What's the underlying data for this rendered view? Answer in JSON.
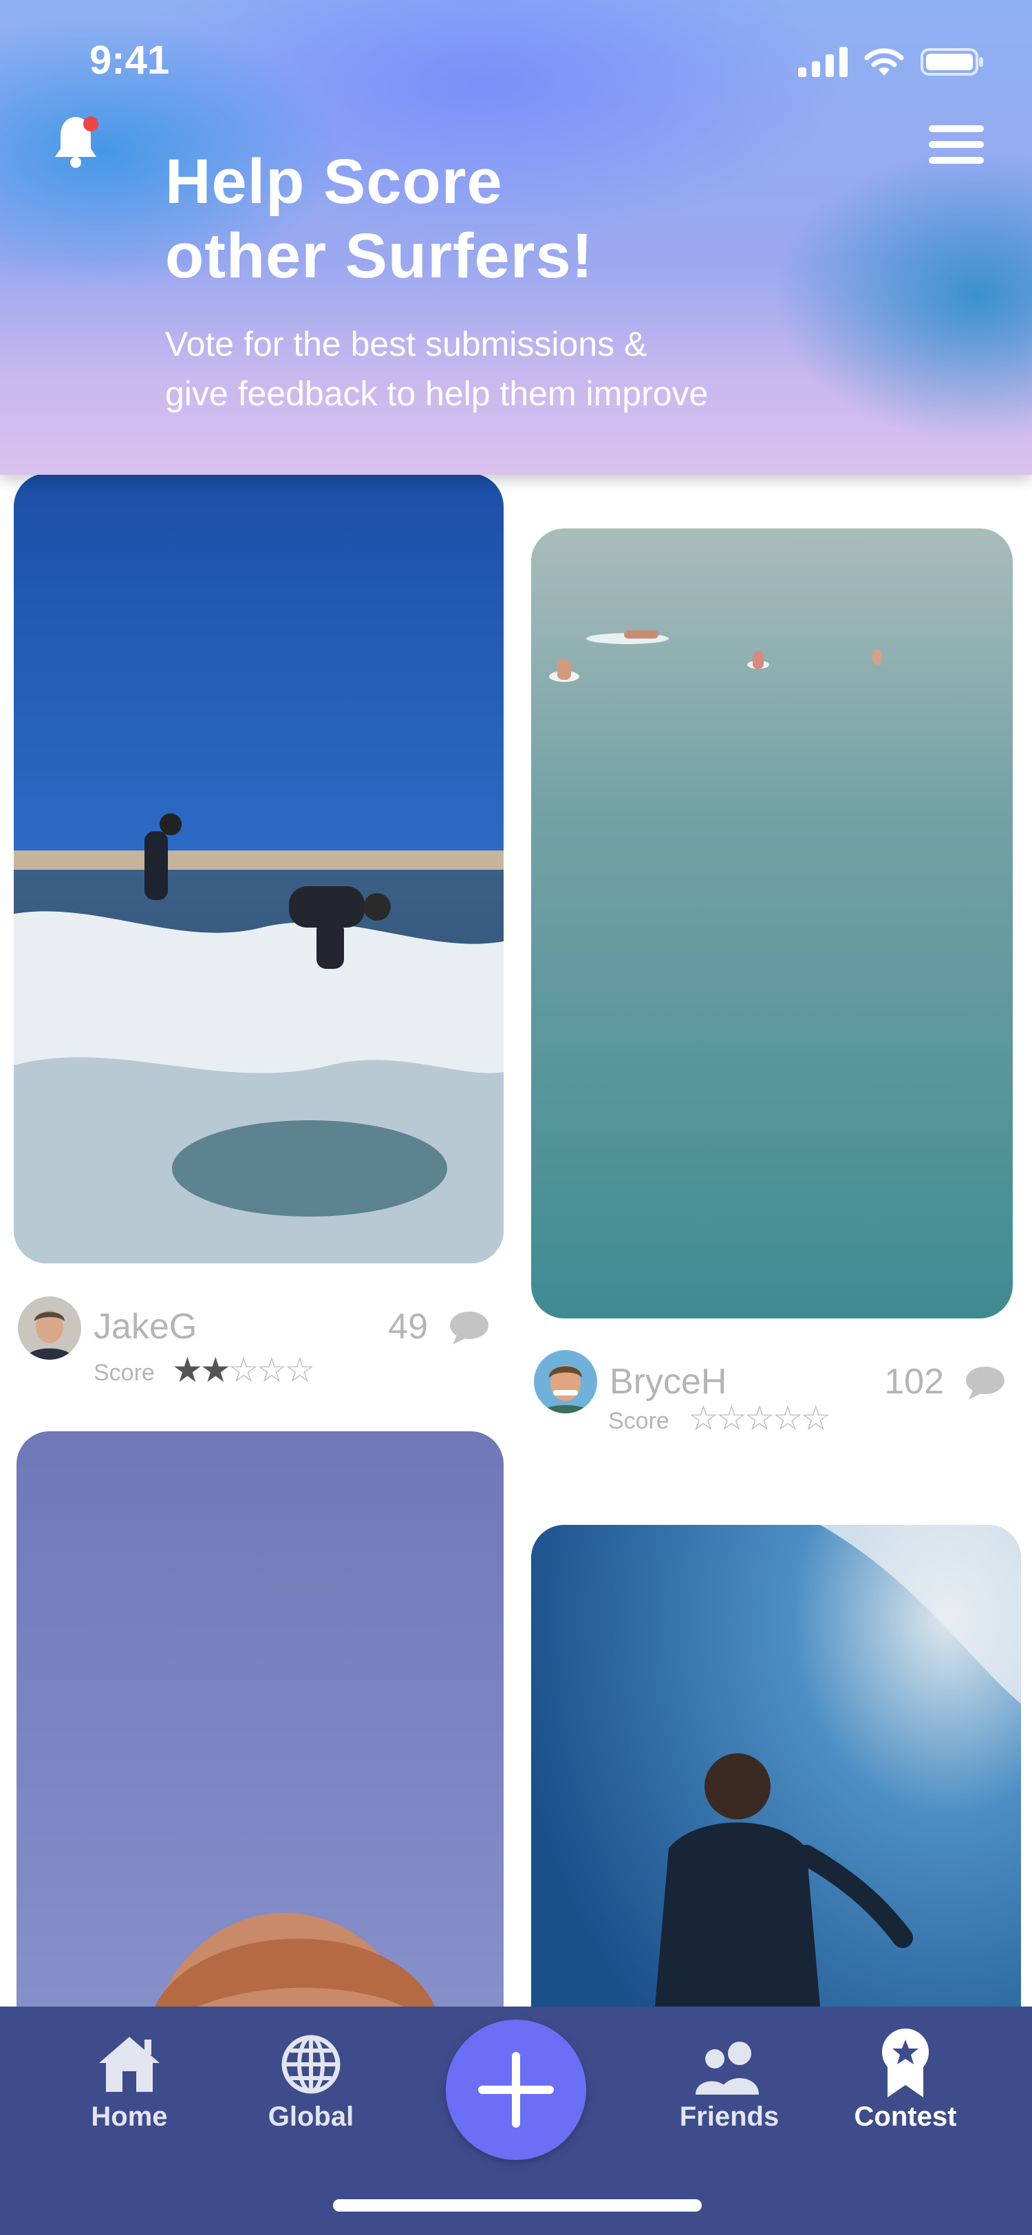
{
  "status_bar": {
    "time": "9:41"
  },
  "header": {
    "title": "Help Score\nother Surfers!",
    "subtitle": "Vote for the best submissions &\ngive feedback to help them improve",
    "has_notification": true
  },
  "feed": {
    "posts": [
      {
        "username": "JakeG",
        "comments": "49",
        "score_label": "Score",
        "rating": 2,
        "max_rating": 5
      },
      {
        "username": "BryceH",
        "comments": "102",
        "score_label": "Score",
        "rating": 0,
        "max_rating": 5
      }
    ]
  },
  "tabbar": {
    "tabs": [
      {
        "label": "Home",
        "icon": "home-icon",
        "active": false
      },
      {
        "label": "Global",
        "icon": "globe-icon",
        "active": false
      },
      {
        "label": "Friends",
        "icon": "friends-icon",
        "active": false
      },
      {
        "label": "Contest",
        "icon": "contest-ribbon-icon",
        "active": true
      }
    ],
    "add_icon": "plus-icon"
  },
  "colors": {
    "tabbar_bg": "#3f4c8c",
    "fab_bg": "#6b6ff6",
    "notification_dot": "#ef4444",
    "muted_text": "#b5b5b5"
  }
}
